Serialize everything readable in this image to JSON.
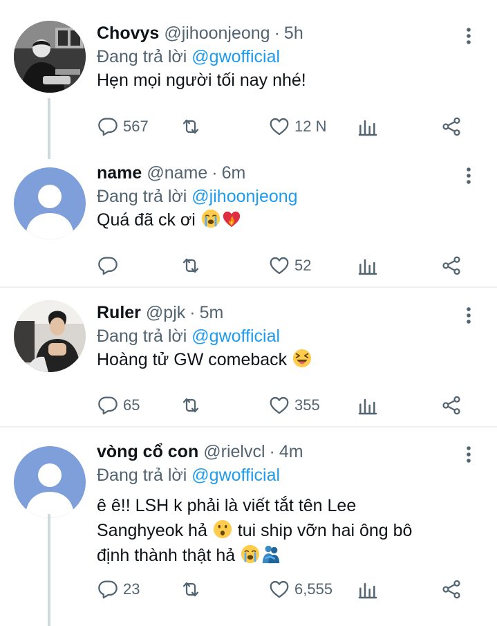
{
  "tweets": [
    {
      "name": "Chovys",
      "handle": "@jihoonjeong",
      "time": "5h",
      "reply_prefix": "Đang trả lời",
      "reply_to": "@gwofficial",
      "text": "Hẹn mọi người tối nay nhé!",
      "emojis": [],
      "reply_count": "567",
      "retweet_count": "",
      "like_count": "12 N",
      "avatar": "photo"
    },
    {
      "name": "name",
      "handle": "@name",
      "time": "6m",
      "reply_prefix": "Đang trả lời",
      "reply_to": "@jihoonjeong",
      "text": "Quá đã ck ơi",
      "emojis": [
        "loudly-crying-face",
        "heart-on-fire"
      ],
      "reply_count": "",
      "retweet_count": "",
      "like_count": "52",
      "avatar": "default"
    },
    {
      "name": "Ruler",
      "handle": "@pjk",
      "time": "5m",
      "reply_prefix": "Đang trả lời",
      "reply_to": "@gwofficial",
      "text": "Hoàng tử GW comeback",
      "emojis": [
        "squinting-face-with-tongue"
      ],
      "reply_count": "65",
      "retweet_count": "",
      "like_count": "355",
      "avatar": "photo"
    },
    {
      "name": "vòng cổ con",
      "handle": "@rielvcl",
      "time": "4m",
      "reply_prefix": "Đang trả lời",
      "reply_to": "@gwofficial",
      "text_line1": "ê ê!! LSH k phải là viết tắt tên Lee",
      "text_line2": "Sanghyeok hả",
      "text_line2b": "tui ship vỡn hai ông bô",
      "text_line3": "định thành thật hả",
      "emojis": [
        "hushed-face",
        "loudly-crying-face",
        "people-hugging"
      ],
      "reply_count": "23",
      "retweet_count": "",
      "like_count": "6,555",
      "avatar": "default"
    }
  ],
  "colors": {
    "accent": "#1d9bf0",
    "secondary_text": "#536471",
    "primary_text": "#0f1419",
    "default_avatar": "#7e9fda"
  }
}
